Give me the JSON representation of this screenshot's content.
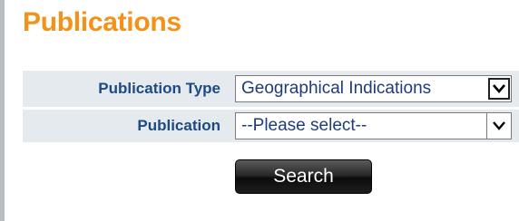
{
  "page": {
    "title": "Publications"
  },
  "form": {
    "publication_type": {
      "label": "Publication Type",
      "selected": "Geographical Indications"
    },
    "publication": {
      "label": "Publication",
      "selected": "--Please select--"
    }
  },
  "actions": {
    "search_label": "Search"
  },
  "icons": {
    "dropdown": "chevron-down-icon"
  },
  "colors": {
    "heading": "#f39118",
    "label": "#1d4a82",
    "row_background": "#e5eaef",
    "button": "#1a1a1a"
  }
}
